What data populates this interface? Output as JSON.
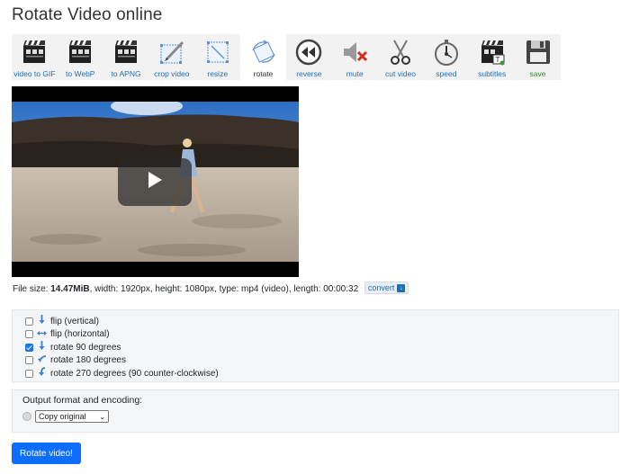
{
  "page": {
    "title": "Rotate Video online"
  },
  "toolbar": {
    "items": [
      {
        "label": "video to GIF",
        "icon": "clapperboard-icon"
      },
      {
        "label": "to WebP",
        "icon": "clapperboard-icon"
      },
      {
        "label": "to APNG",
        "icon": "clapperboard-icon"
      },
      {
        "label": "crop video",
        "icon": "crop-icon"
      },
      {
        "label": "resize",
        "icon": "resize-icon"
      },
      {
        "label": "rotate",
        "icon": "rotate-icon",
        "active": true
      },
      {
        "label": "reverse",
        "icon": "rewind-icon"
      },
      {
        "label": "mute",
        "icon": "mute-icon"
      },
      {
        "label": "cut video",
        "icon": "scissors-icon"
      },
      {
        "label": "speed",
        "icon": "stopwatch-icon"
      },
      {
        "label": "subtitles",
        "icon": "subtitles-icon"
      },
      {
        "label": "save",
        "icon": "floppy-disk-icon"
      }
    ],
    "label_color": "#1d6fb8",
    "save_color": "#2e8b2e"
  },
  "video": {
    "play_icon": "play-icon"
  },
  "file_info": {
    "prefix": "File size: ",
    "size": "14.47MiB",
    "details": ", width: 1920px, height: 1080px, type: mp4 (video), length: 00:00:32",
    "convert_label": "convert"
  },
  "options": [
    {
      "label": "flip (vertical)",
      "checked": false,
      "icon": "arrow-down-icon"
    },
    {
      "label": "flip (horizontal)",
      "checked": false,
      "icon": "arrow-left-right-icon"
    },
    {
      "label": "rotate 90 degrees",
      "checked": true,
      "icon": "arrow-down-icon"
    },
    {
      "label": "rotate 180 degrees",
      "checked": false,
      "icon": "arrow-curve-left-icon"
    },
    {
      "label": "rotate 270 degrees (90 counter-clockwise)",
      "checked": false,
      "icon": "arrow-curve-down-icon"
    }
  ],
  "output": {
    "heading": "Output format and encoding:",
    "select_value": "Copy original"
  },
  "submit": {
    "label": "Rotate video!"
  },
  "colors": {
    "accent": "#0d6efd",
    "checkbox": "#1a73e8",
    "panel_bg": "#f4f5f6"
  }
}
